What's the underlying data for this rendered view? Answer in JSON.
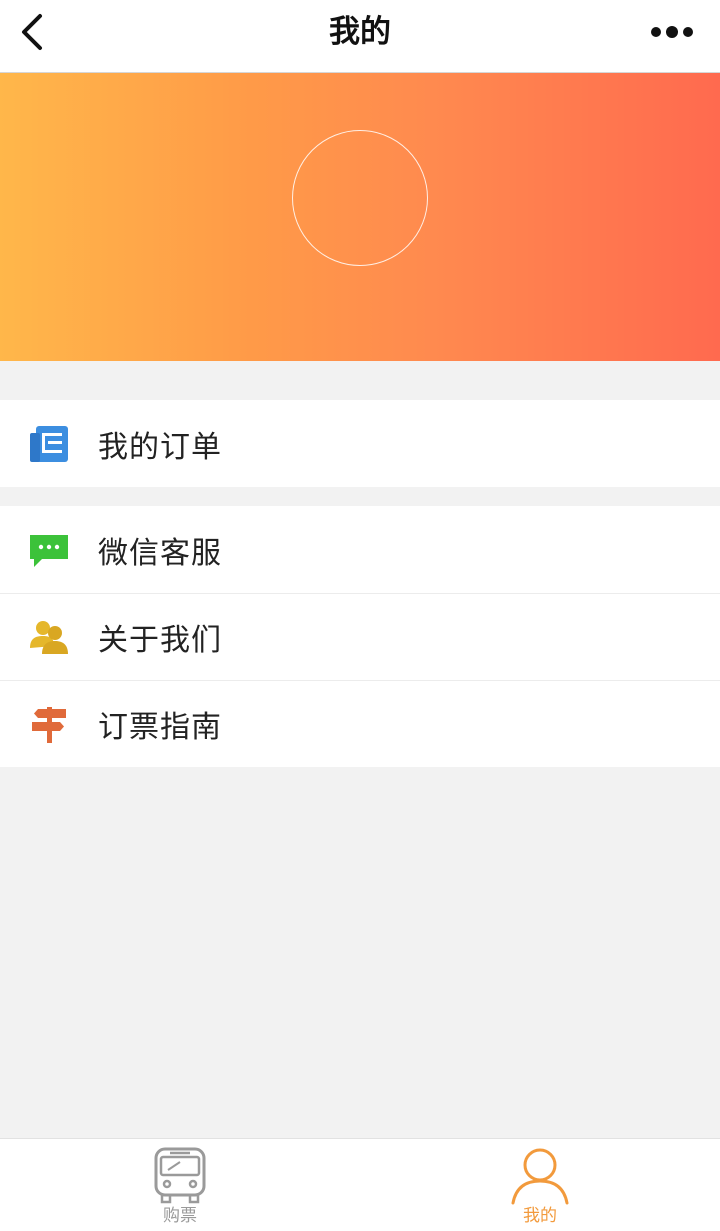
{
  "navbar": {
    "title": "我的",
    "back_icon": "chevron-left-icon",
    "more_icon": "more-dots-icon"
  },
  "banner": {
    "gradient_colors": [
      "#ffb74a",
      "#ff9a48",
      "#ff6a4f"
    ]
  },
  "menu": {
    "group1": [
      {
        "label": "我的订单",
        "icon": "orders-icon",
        "icon_color": "#3c8ee0"
      }
    ],
    "group2": [
      {
        "label": "微信客服",
        "icon": "chat-icon",
        "icon_color": "#3cc23a"
      },
      {
        "label": "关于我们",
        "icon": "users-icon",
        "icon_color": "#e5b72b"
      },
      {
        "label": "订票指南",
        "icon": "signpost-icon",
        "icon_color": "#e06a3a"
      }
    ]
  },
  "tabbar": {
    "tabs": [
      {
        "label": "购票",
        "icon": "bus-icon",
        "active": false,
        "color": "#9a9a9a"
      },
      {
        "label": "我的",
        "icon": "person-icon",
        "active": true,
        "color": "#f29a3c"
      }
    ]
  }
}
